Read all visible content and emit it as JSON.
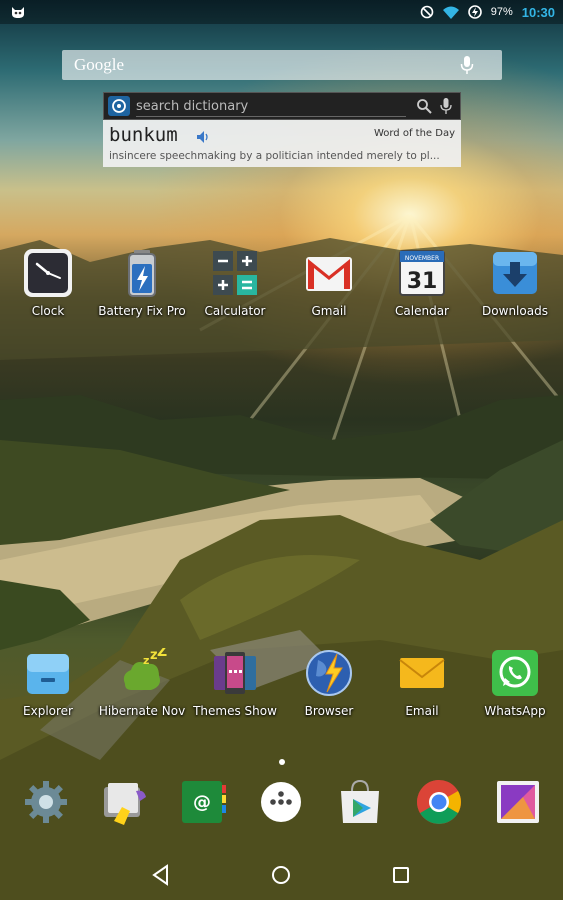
{
  "status_bar": {
    "notification_icon": "cat-ghost-icon",
    "icons": [
      "do-not-disturb-icon",
      "wifi-icon",
      "battery-icon"
    ],
    "battery_percent": "97%",
    "time": "10:30",
    "time_color": "#33b5e5"
  },
  "search_bar": {
    "label": "Google",
    "icon": "mic-icon"
  },
  "dictionary_widget": {
    "placeholder": "search dictionary",
    "word": "bunkum",
    "badge": "Word of the Day",
    "definition": "insincere speechmaking by a politician intended merely to pl..."
  },
  "apps_row1": [
    {
      "label": "Clock",
      "icon": "clock-icon"
    },
    {
      "label": "Battery Fix Pro",
      "icon": "battery-fix-icon"
    },
    {
      "label": "Calculator",
      "icon": "calculator-icon"
    },
    {
      "label": "Gmail",
      "icon": "gmail-icon"
    },
    {
      "label": "Calendar",
      "icon": "calendar-icon",
      "month": "NOVEMBER",
      "day": "31"
    },
    {
      "label": "Downloads",
      "icon": "downloads-icon"
    }
  ],
  "apps_row2": [
    {
      "label": "Explorer",
      "icon": "explorer-icon"
    },
    {
      "label": "Hibernate Nov",
      "icon": "hibernate-icon"
    },
    {
      "label": "Themes Show",
      "icon": "themes-icon"
    },
    {
      "label": "Browser",
      "icon": "browser-icon"
    },
    {
      "label": "Email",
      "icon": "email-icon"
    },
    {
      "label": "WhatsApp",
      "icon": "whatsapp-icon"
    }
  ],
  "dock": [
    "settings-icon",
    "file-manager-icon",
    "contacts-icon",
    "app-drawer-icon",
    "play-store-icon",
    "chrome-icon",
    "gallery-icon"
  ],
  "navbar": [
    "back-icon",
    "home-icon",
    "recents-icon"
  ]
}
